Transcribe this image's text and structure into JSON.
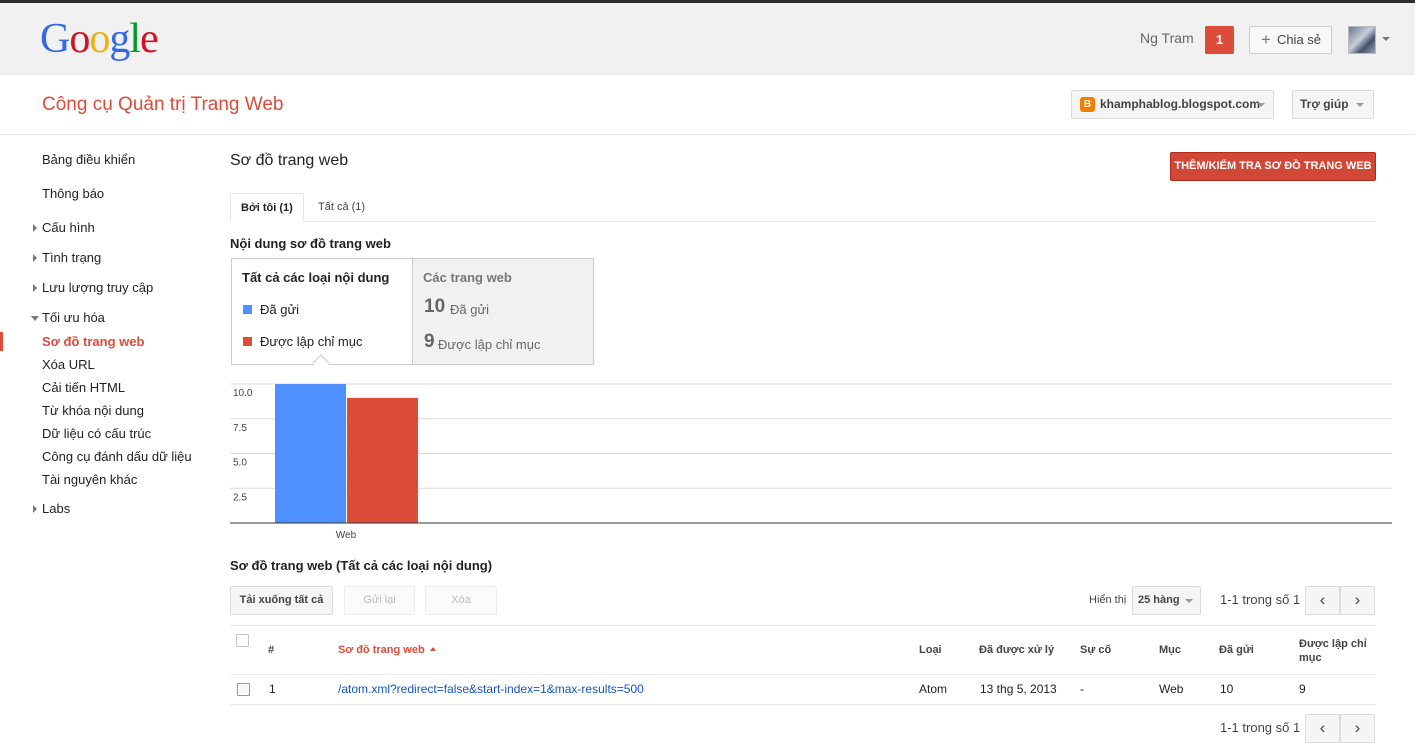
{
  "header": {
    "logo_letters": [
      {
        "ch": "G",
        "color": "#3369e8"
      },
      {
        "ch": "o",
        "color": "#d50f25"
      },
      {
        "ch": "o",
        "color": "#eeb211"
      },
      {
        "ch": "g",
        "color": "#3369e8"
      },
      {
        "ch": "l",
        "color": "#009925"
      },
      {
        "ch": "e",
        "color": "#d50f25"
      }
    ],
    "user_name": "Ng Tram",
    "notification_count": "1",
    "share_label": "Chia sẻ"
  },
  "app": {
    "title": "Công cụ Quản trị Trang Web",
    "site": "khamphablog.blogspot.com",
    "help_label": "Trợ giúp"
  },
  "sidebar": {
    "dashboard": "Bảng điều khiển",
    "messages": "Thông báo",
    "configuration": "Cấu hình",
    "health": "Tình trạng",
    "traffic": "Lưu lượng truy cập",
    "optimization": "Tối ưu hóa",
    "sitemaps": "Sơ đồ trang web",
    "remove_urls": "Xóa URL",
    "html_improvements": "Cải tiến HTML",
    "content_keywords": "Từ khóa nội dung",
    "structured_data": "Dữ liệu có cấu trúc",
    "data_highlighter": "Công cụ đánh dấu dữ liệu",
    "other_resources": "Tài nguyên khác",
    "labs": "Labs"
  },
  "main": {
    "title": "Sơ đồ trang web",
    "add_test_button": "THÊM/KIỂM TRA SƠ ĐỒ TRANG WEB",
    "tab_by_me": "Bởi tôi (1)",
    "tab_all": "Tất cả (1)",
    "content_section_title": "Nội dung sơ đồ trang web",
    "legend": {
      "all_types": "Tất cả các loại nội dung",
      "submitted": "Đã gửi",
      "indexed": "Được lập chỉ mục",
      "web_pages": "Các trang web",
      "submitted_count": "10",
      "indexed_count": "9"
    },
    "table_section_title": "Sơ đồ trang web (Tất cả các loại nội dung)",
    "download_all": "Tải xuống tất cả",
    "resubmit": "Gửi lại",
    "delete": "Xóa",
    "show_label": "Hiển thị",
    "rows_per_page": "25 hàng",
    "range_text": "1-1 trong số 1"
  },
  "colors": {
    "submitted": "#4d90fe",
    "indexed": "#dd4b39",
    "accent": "#dd4b39"
  },
  "chart_data": {
    "type": "bar",
    "categories": [
      "Web"
    ],
    "series": [
      {
        "name": "Đã gửi",
        "values": [
          10
        ]
      },
      {
        "name": "Được lập chỉ mục",
        "values": [
          9
        ]
      }
    ],
    "ylim": [
      0,
      10
    ],
    "yticks": [
      "10.0",
      "7.5",
      "5.0",
      "2.5"
    ],
    "grid": true
  },
  "table": {
    "headers": {
      "num": "#",
      "sitemap": "Sơ đồ trang web",
      "type": "Loại",
      "processed": "Đã được xử lý",
      "issues": "Sự cố",
      "items": "Mục",
      "submitted": "Đã gửi",
      "indexed": "Được lập chỉ mục"
    },
    "rows": [
      {
        "num": "1",
        "sitemap": "/atom.xml?redirect=false&start-index=1&max-results=500",
        "type": "Atom",
        "processed": "13 thg 5, 2013",
        "issues": "-",
        "items": "Web",
        "submitted": "10",
        "indexed": "9"
      }
    ]
  }
}
